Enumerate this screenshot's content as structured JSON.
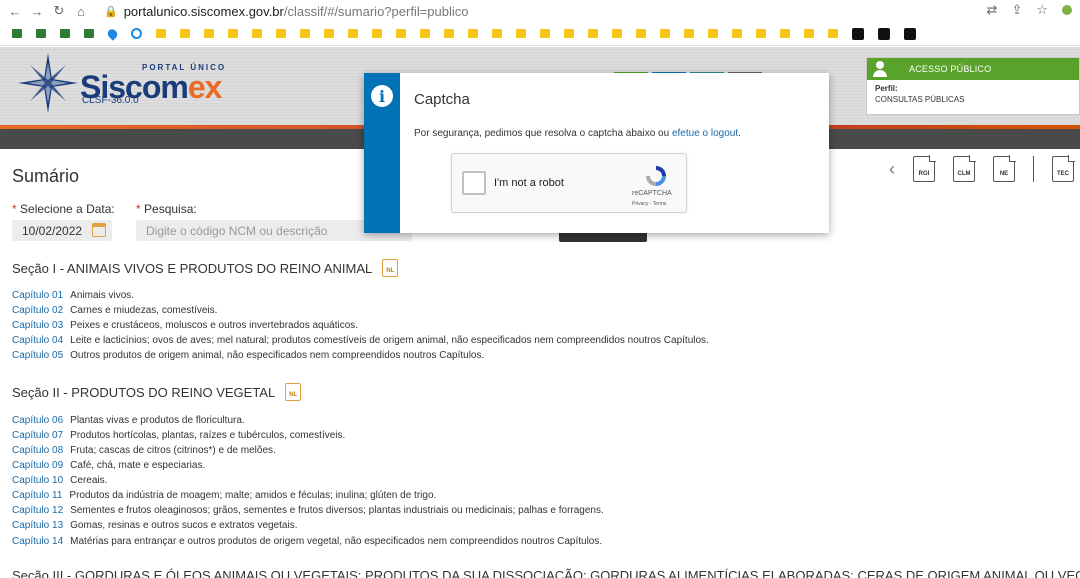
{
  "browser": {
    "url_host": "portalunico.siscomex.gov.br",
    "url_path": "/classif/#/sumario?perfil=publico"
  },
  "header": {
    "logo_small": "PORTAL ÚNICO",
    "logo_main_a": "Siscom",
    "logo_main_b": "ex",
    "version": "CLSF-36.0.0",
    "access_title": "ACESSO PÚBLICO",
    "profile_label": "Perfil:",
    "profile_value": "CONSULTAS PÚBLICAS"
  },
  "page": {
    "title": "Sumário",
    "icons": [
      "RGI",
      "CLM",
      "NE",
      "TEC"
    ],
    "date_label": "Selecione a Data:",
    "date_value": "10/02/2022",
    "search_label": "Pesquisa:",
    "search_placeholder": "Digite o código NCM ou descrição"
  },
  "modal": {
    "title": "Captcha",
    "message_before": "Por segurança, pedimos que resolva o captcha abaixo ou ",
    "message_link": "efetue o logout",
    "message_after": ".",
    "captcha_label": "I'm not a robot",
    "captcha_brand": "reCAPTCHA",
    "captcha_terms": "Privacy - Terms"
  },
  "icon_text": "NL",
  "sections": [
    {
      "title": "Seção I - ANIMAIS VIVOS E PRODUTOS DO REINO ANIMAL",
      "chapters": [
        {
          "num": "Capítulo 01",
          "desc": "Animais vivos."
        },
        {
          "num": "Capítulo 02",
          "desc": "Carnes e miudezas, comestíveis."
        },
        {
          "num": "Capítulo 03",
          "desc": "Peixes e crustáceos, moluscos e outros invertebrados aquáticos."
        },
        {
          "num": "Capítulo 04",
          "desc": "Leite e lacticínios; ovos de aves; mel natural; produtos comestíveis de origem animal, não especificados nem compreendidos noutros Capítulos."
        },
        {
          "num": "Capítulo 05",
          "desc": "Outros produtos de origem animal, não especificados nem compreendidos noutros Capítulos."
        }
      ]
    },
    {
      "title": "Seção II - PRODUTOS DO REINO VEGETAL",
      "chapters": [
        {
          "num": "Capítulo 06",
          "desc": "Plantas vivas e produtos de floricultura."
        },
        {
          "num": "Capítulo 07",
          "desc": "Produtos hortícolas, plantas, raízes e tubérculos, comestíveis."
        },
        {
          "num": "Capítulo 08",
          "desc": "Fruta; cascas de citros (citrinos*) e de melões."
        },
        {
          "num": "Capítulo 09",
          "desc": "Café, chá, mate e especiarias."
        },
        {
          "num": "Capítulo 10",
          "desc": "Cereais."
        },
        {
          "num": "Capítulo 11",
          "desc": "Produtos da indústria de moagem; malte; amidos e féculas; inulina; glúten de trigo."
        },
        {
          "num": "Capítulo 12",
          "desc": "Sementes e frutos oleaginosos; grãos, sementes e frutos diversos; plantas industriais ou medicinais; palhas e forragens."
        },
        {
          "num": "Capítulo 13",
          "desc": "Gomas, resinas e outros sucos e extratos vegetais."
        },
        {
          "num": "Capítulo 14",
          "desc": "Matérias para entrançar e outros produtos de origem vegetal, não especificados nem compreendidos noutros Capítulos."
        }
      ]
    },
    {
      "title": "Seção III - GORDURAS E ÓLEOS ANIMAIS OU VEGETAIS; PRODUTOS DA SUA DISSOCIAÇÃO; GORDURAS ALIMENTÍCIAS ELABORADAS; CERAS DE ORIGEM ANIMAL OU VEGETAL",
      "chapters": []
    }
  ]
}
